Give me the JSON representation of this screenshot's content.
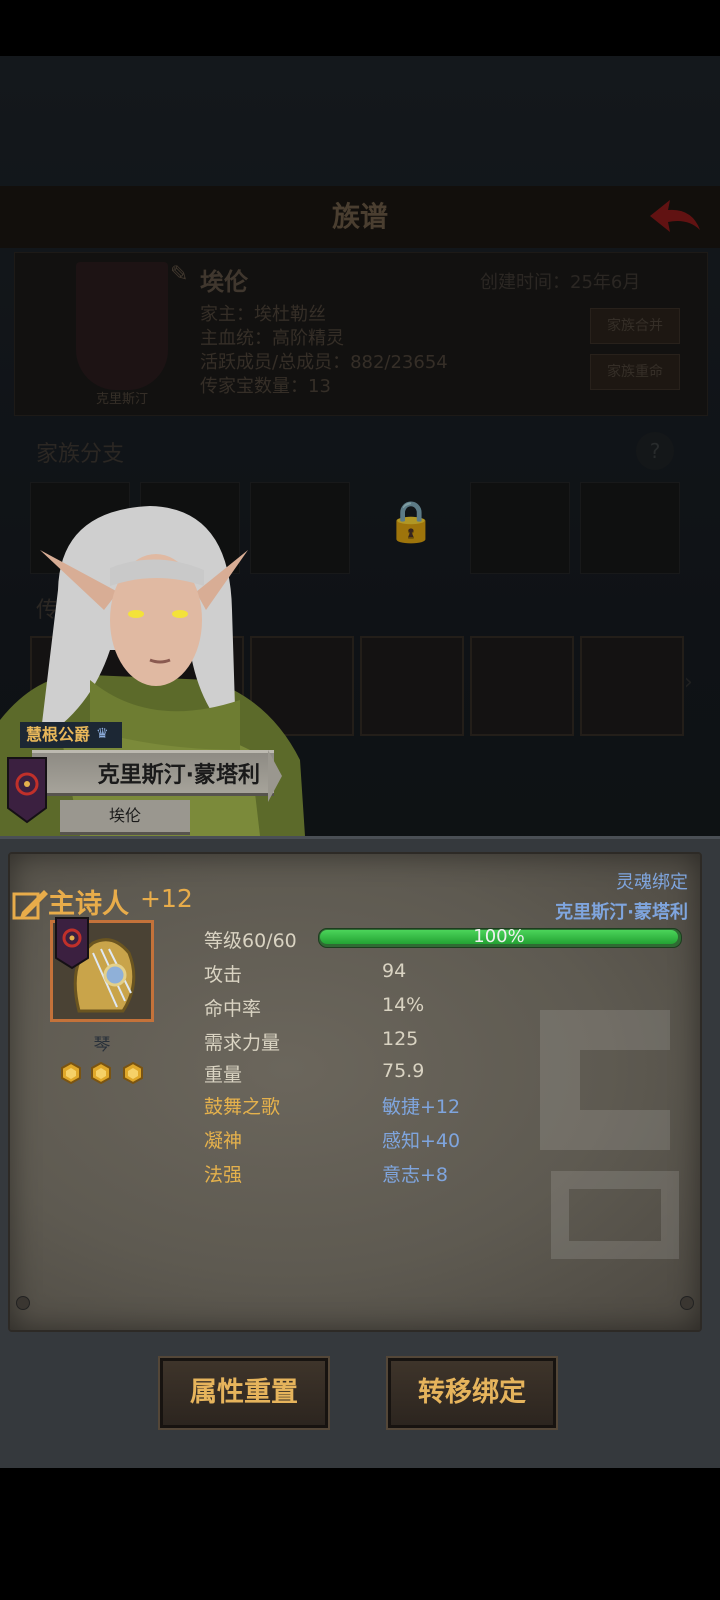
{
  "background": {
    "page_title": "族谱",
    "back_icon": "back-arrow-icon",
    "family_name": "埃伦",
    "emblem_label": "克里斯汀",
    "founded_label": "创建时间：25年6月",
    "info_lines": [
      "家主：埃杜勒丝",
      "主血统：高阶精灵",
      "活跃成员/总成员：882/23654",
      "传家宝数量：13"
    ],
    "buttons": [
      "家族合并",
      "家族重命"
    ],
    "branch_title": "家族分支",
    "help_icon": "?",
    "legend_title": "传家宝"
  },
  "character": {
    "title": "慧根公爵",
    "name": "克里斯汀·蒙塔利",
    "house": "埃伦"
  },
  "item": {
    "name": "主诗人",
    "enhance": "+12",
    "type": "琴",
    "gems": 3,
    "soul_bind_label": "灵魂绑定",
    "soul_bind_owner": "克里斯汀·蒙塔利",
    "level_label": "等级60/60",
    "level_progress": 1.0,
    "level_percent_text": "100%",
    "stats": [
      {
        "label": "攻击",
        "value": "94",
        "special": false
      },
      {
        "label": "命中率",
        "value": "14%",
        "special": false
      },
      {
        "label": "需求力量",
        "value": "125",
        "special": false
      },
      {
        "label": "重量",
        "value": "75.9",
        "special": false
      },
      {
        "label": "鼓舞之歌",
        "value": "敏捷+12",
        "special": true
      },
      {
        "label": "凝神",
        "value": "感知+40",
        "special": true
      },
      {
        "label": "法强",
        "value": "意志+8",
        "special": true
      }
    ]
  },
  "actions": {
    "reset_label": "属性重置",
    "transfer_label": "转移绑定"
  },
  "colors": {
    "gold": "#e8ac4a",
    "blue": "#7fa5de",
    "exp_green": "#2fbf40"
  }
}
